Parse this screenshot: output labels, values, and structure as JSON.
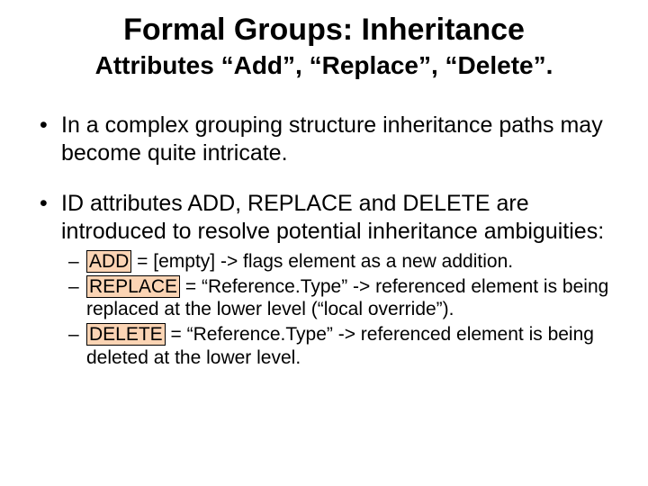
{
  "title": "Formal Groups: Inheritance",
  "subtitle": "Attributes “Add”, “Replace”, “Delete”.",
  "bullets": [
    {
      "text": "In a complex grouping structure inheritance paths may become quite intricate."
    },
    {
      "text": "ID attributes ADD, REPLACE and DELETE are introduced to resolve potential inheritance ambiguities:",
      "sub": [
        {
          "kw": "ADD",
          "rest": " = [empty] -> flags element as a new addition."
        },
        {
          "kw": "REPLACE",
          "rest": " = “Reference.Type” -> referenced element is being replaced at the lower level (“local override”)."
        },
        {
          "kw": "DELETE",
          "rest": " = “Reference.Type” -> referenced element is being deleted at the lower level."
        }
      ]
    }
  ]
}
